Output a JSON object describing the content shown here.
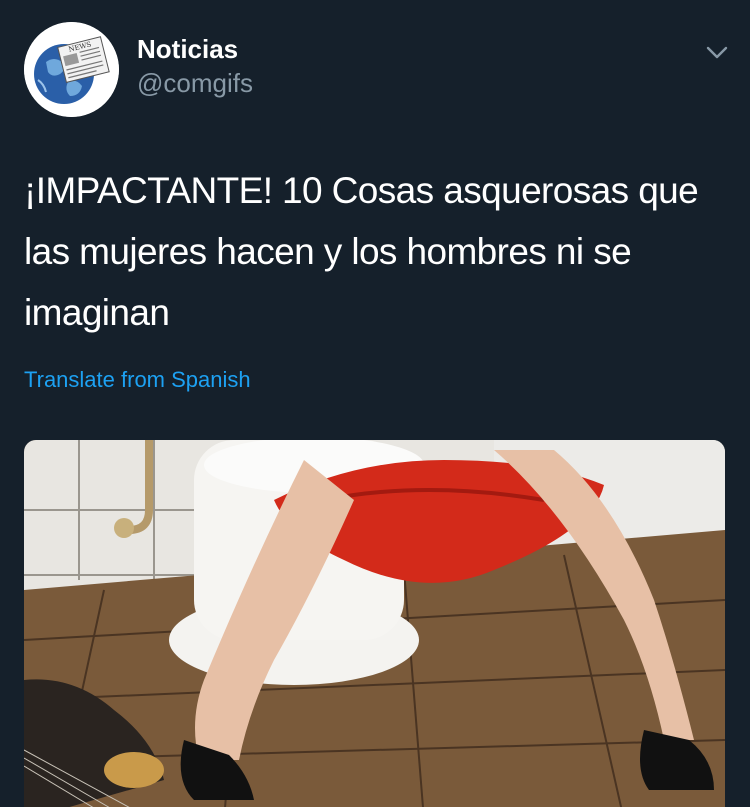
{
  "author": {
    "display_name": "Noticias",
    "handle": "@comgifs",
    "avatar": {
      "icon": "news-globe-icon",
      "badge_text": "NEWS"
    }
  },
  "tweet": {
    "text": "¡IMPACTANTE! 10 Cosas asquerosas que las mujeres hacen y los hombres ni se imaginan",
    "translate_label": "Translate from Spanish"
  },
  "menu": {
    "icon": "chevron-down-icon"
  },
  "media": {
    "icon": "photo-thumbnail",
    "subject": "woman seated on toilet in a tiled bathroom"
  },
  "colors": {
    "background": "#15202b",
    "text_primary": "#ffffff",
    "text_secondary": "#8899a6",
    "link": "#1da1f2"
  }
}
